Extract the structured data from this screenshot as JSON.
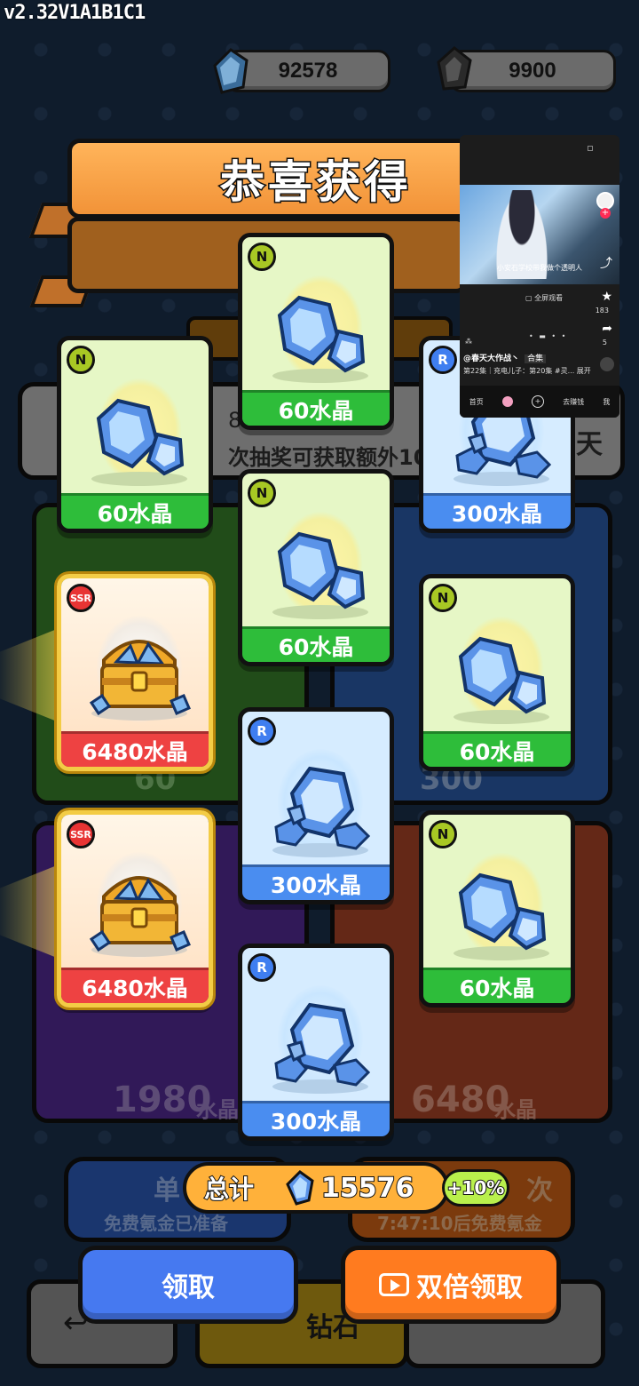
{
  "version": "v2.32V1A1B1C1",
  "resources": [
    {
      "icon": "crystal-icon",
      "value": "92578"
    },
    {
      "icon": "dark-crystal-icon",
      "value": "9900"
    }
  ],
  "banner_title": "恭喜获得",
  "background": {
    "info_line_1": "8",
    "info_line_2": "次抽奖可获取额外10",
    "info_right": "天",
    "panel_values": [
      {
        "amount": "60",
        "unit": "水晶"
      },
      {
        "amount": "300",
        "unit": "水晶"
      },
      {
        "amount": "1980",
        "unit": "水晶"
      },
      {
        "amount": "6480",
        "unit": "水晶"
      }
    ],
    "single_draw_label": "单",
    "single_draw_sub": "免费氪金已准备",
    "multi_draw_label": "次",
    "multi_draw_sub": "7:47:10后免费氪金",
    "bottom_left_arrow": "↩",
    "bottom_mid": "钻石"
  },
  "cards": [
    {
      "rarity": "N",
      "reward": "60水晶",
      "art": "crystal-small-icon"
    },
    {
      "rarity": "N",
      "reward": "60水晶",
      "art": "crystal-small-icon"
    },
    {
      "rarity": "R",
      "reward": "300水晶",
      "art": "crystal-pile-icon"
    },
    {
      "rarity": "SSR",
      "reward": "6480水晶",
      "art": "treasure-chest-icon"
    },
    {
      "rarity": "N",
      "reward": "60水晶",
      "art": "crystal-small-icon"
    },
    {
      "rarity": "N",
      "reward": "60水晶",
      "art": "crystal-small-icon"
    },
    {
      "rarity": "SSR",
      "reward": "6480水晶",
      "art": "treasure-chest-icon"
    },
    {
      "rarity": "R",
      "reward": "300水晶",
      "art": "crystal-pile-icon"
    },
    {
      "rarity": "N",
      "reward": "60水晶",
      "art": "crystal-small-icon"
    },
    {
      "rarity": "R",
      "reward": "300水晶",
      "art": "crystal-pile-icon"
    }
  ],
  "total": {
    "label": "总计",
    "value": "15576",
    "bonus": "+10%"
  },
  "buttons": {
    "claim": "领取",
    "double_claim": "双倍领取"
  },
  "video_overlay": {
    "caption": "小安石学校带我做个透明人",
    "fullscreen": "全屏观看",
    "likes": "183",
    "shares": "5",
    "author": "@春天大作战丶",
    "collection": "合集",
    "desc": "第22集｜充电儿子：第20集 #灵... 展开",
    "nav": [
      "首页",
      "去赚钱",
      "我"
    ]
  },
  "colors": {
    "n_label": "#2ebd3a",
    "r_label": "#4a8df0",
    "ssr_label": "#ee4242",
    "claim": "#4679f0",
    "double": "#ff7b1f"
  }
}
